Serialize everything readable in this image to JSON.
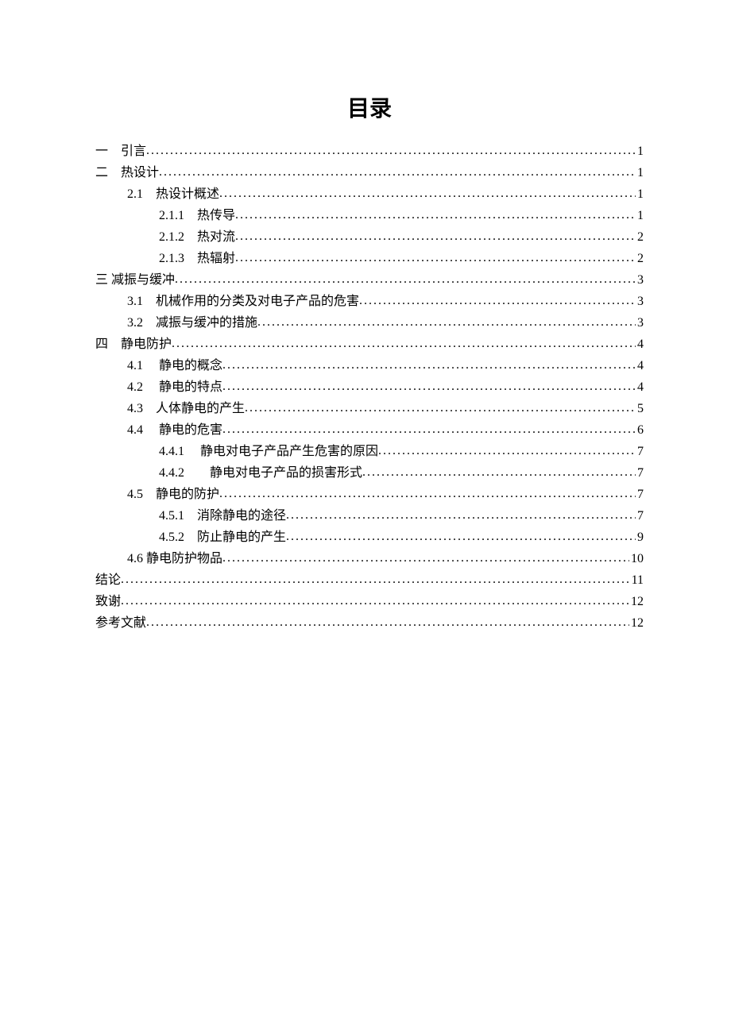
{
  "title": "目录",
  "toc": [
    {
      "indent": 0,
      "text": "一　引言",
      "page": "1"
    },
    {
      "indent": 0,
      "text": "二　热设计",
      "page": "1"
    },
    {
      "indent": 1,
      "text": "2.1　热设计概述 ",
      "page": "1"
    },
    {
      "indent": 2,
      "text": "2.1.1　热传导",
      "page": "1"
    },
    {
      "indent": 2,
      "text": "2.1.2　热对流",
      "page": "2"
    },
    {
      "indent": 2,
      "text": "2.1.3　热辐射",
      "page": "2"
    },
    {
      "indent": 0,
      "text": "三 减振与缓冲",
      "page": "3"
    },
    {
      "indent": 1,
      "text": "3.1　机械作用的分类及对电子产品的危害 ",
      "page": "3"
    },
    {
      "indent": 1,
      "text": "3.2　减振与缓冲的措施 ",
      "page": "3"
    },
    {
      "indent": 0,
      "text": "四　静电防护",
      "page": "4"
    },
    {
      "indent": 1,
      "text": "4.1　 静电的概念 ",
      "page": "4"
    },
    {
      "indent": 1,
      "text": "4.2　 静电的特点 ",
      "page": "4"
    },
    {
      "indent": 1,
      "text": "4.3　人体静电的产生 ",
      "page": "5"
    },
    {
      "indent": 1,
      "text": "4.4　 静电的危害 ",
      "page": "6"
    },
    {
      "indent": 2,
      "text": "4.4.1　 静电对电子产品产生危害的原因",
      "page": "7"
    },
    {
      "indent": 2,
      "text": "4.4.2　　静电对电子产品的损害形式",
      "page": "7"
    },
    {
      "indent": 1,
      "text": "4.5　静电的防护 ",
      "page": "7"
    },
    {
      "indent": 2,
      "text": "4.5.1　消除静电的途径",
      "page": "7"
    },
    {
      "indent": 2,
      "text": "4.5.2　防止静电的产生",
      "page": "9"
    },
    {
      "indent": 1,
      "text": "4.6 静电防护物品",
      "page": "10"
    },
    {
      "indent": 0,
      "text": "结论",
      "page": "11"
    },
    {
      "indent": 0,
      "text": "致谢",
      "page": "12"
    },
    {
      "indent": 0,
      "text": "参考文献",
      "page": "12"
    }
  ]
}
